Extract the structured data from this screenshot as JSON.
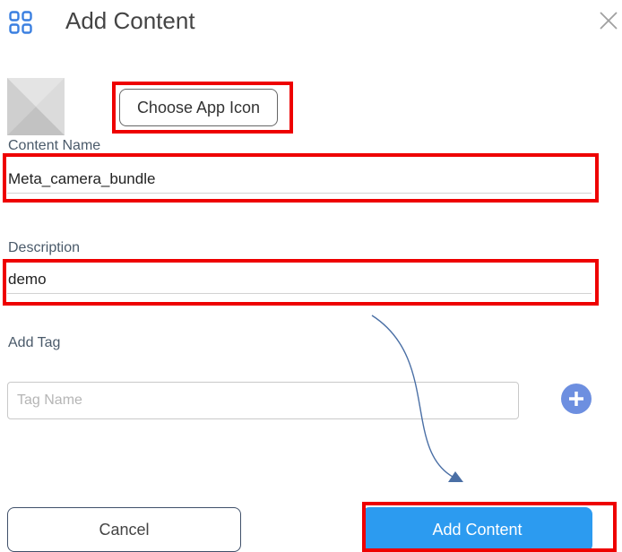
{
  "header": {
    "title": "Add Content",
    "menu_icon": "apps-grid-icon",
    "close_icon": "close-icon"
  },
  "app_icon": {
    "placeholder_icon": "image-placeholder-icon",
    "choose_label": "Choose App Icon"
  },
  "content_name": {
    "label": "Content Name",
    "value": "Meta_camera_bundle"
  },
  "description": {
    "label": "Description",
    "value": "demo"
  },
  "tags": {
    "label": "Add Tag",
    "placeholder": "Tag Name",
    "add_icon": "plus-circle-icon"
  },
  "actions": {
    "cancel_label": "Cancel",
    "submit_label": "Add Content"
  },
  "colors": {
    "accent": "#2c9bf0",
    "plus_button": "#6d8fe0",
    "icon_blue": "#3a7fe0",
    "highlight": "#ee0000",
    "arrow": "#4a6fa5"
  }
}
